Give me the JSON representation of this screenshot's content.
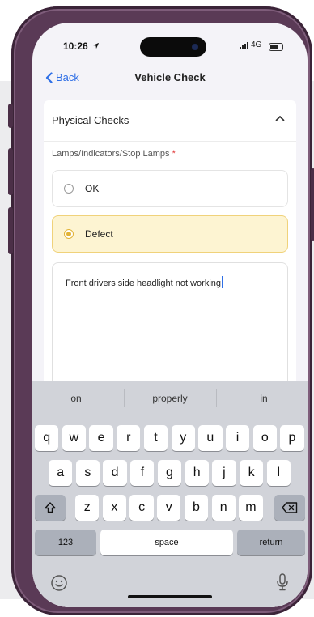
{
  "status_bar": {
    "time": "10:26",
    "network": "4G"
  },
  "nav": {
    "back_label": "Back",
    "title": "Vehicle Check"
  },
  "section": {
    "title": "Physical Checks"
  },
  "field": {
    "label": "Lamps/Indicators/Stop Lamps",
    "required_mark": "*",
    "options": [
      {
        "label": "OK",
        "selected": false
      },
      {
        "label": "Defect",
        "selected": true
      }
    ],
    "notes_text_part1": "Front drivers side headlight not ",
    "notes_text_part2": "working"
  },
  "keyboard": {
    "suggestions": [
      "on",
      "properly",
      "in"
    ],
    "row1": [
      "q",
      "w",
      "e",
      "r",
      "t",
      "y",
      "u",
      "i",
      "o",
      "p"
    ],
    "row2": [
      "a",
      "s",
      "d",
      "f",
      "g",
      "h",
      "j",
      "k",
      "l"
    ],
    "row3": [
      "z",
      "x",
      "c",
      "v",
      "b",
      "n",
      "m"
    ],
    "numbers_label": "123",
    "space_label": "space",
    "return_label": "return"
  },
  "colors": {
    "accent": "#2f6fe6",
    "defect_bg": "#fdf4d2",
    "defect_border": "#f0d27a",
    "radio_selected": "#e2b337",
    "frame": "#5a3a56"
  },
  "icons": [
    "location-arrow-icon",
    "chevron-left-icon",
    "chevron-up-icon",
    "shift-icon",
    "backspace-icon",
    "emoji-icon",
    "microphone-icon"
  ]
}
